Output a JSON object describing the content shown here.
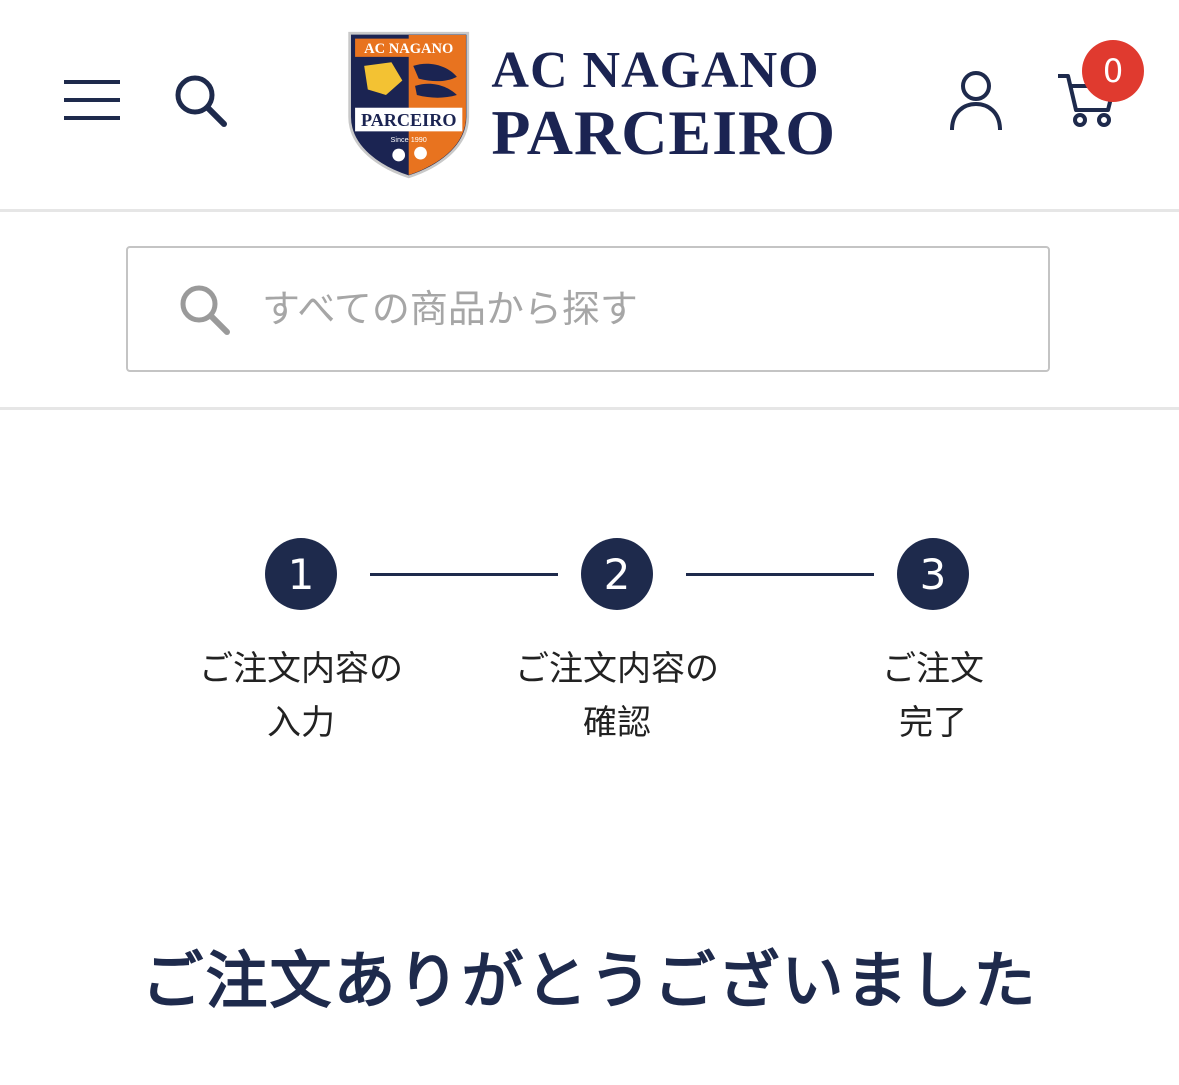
{
  "header": {
    "menu_icon": "hamburger-menu-icon",
    "search_icon": "search-icon",
    "account_icon": "user-account-icon",
    "cart_icon": "shopping-cart-icon",
    "cart_count": "0",
    "logo": {
      "emblem_text_top": "AC NAGANO",
      "emblem_text_band": "PARCEIRO",
      "emblem_text_since": "Since 1990",
      "wordmark_line1": "AC NAGANO",
      "wordmark_line2": "PARCEIRO"
    },
    "colors": {
      "navy": "#1e2a4c",
      "badge_red": "#e03a2f",
      "emblem_orange": "#e8731f"
    }
  },
  "search": {
    "placeholder": "すべての商品から探す",
    "value": ""
  },
  "steps": [
    {
      "number": "1",
      "label_line1": "ご注文内容の",
      "label_line2": "入力"
    },
    {
      "number": "2",
      "label_line1": "ご注文内容の",
      "label_line2": "確認"
    },
    {
      "number": "3",
      "label_line1": "ご注文",
      "label_line2": "完了"
    }
  ],
  "main": {
    "heading": "ご注文ありがとうございました"
  }
}
